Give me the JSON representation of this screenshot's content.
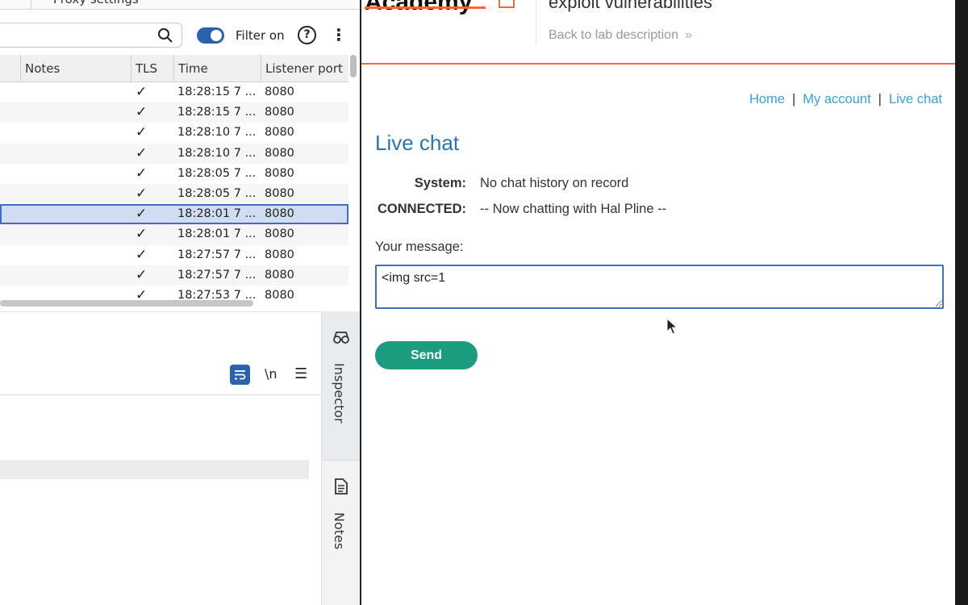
{
  "proxy": {
    "top_cut_text": "Proxy settings",
    "filter": {
      "placeholder": "",
      "filter_label": "Filter on",
      "help_label": "?",
      "more_label": "⋮"
    },
    "columns": [
      "Notes",
      "TLS",
      "Time",
      "Listener port"
    ],
    "rows": [
      {
        "tls": "✓",
        "time": "18:28:15 7 ...",
        "port": "8080"
      },
      {
        "tls": "✓",
        "time": "18:28:15 7 ...",
        "port": "8080"
      },
      {
        "tls": "✓",
        "time": "18:28:10 7 ...",
        "port": "8080"
      },
      {
        "tls": "✓",
        "time": "18:28:10 7 ...",
        "port": "8080"
      },
      {
        "tls": "✓",
        "time": "18:28:05 7 ...",
        "port": "8080"
      },
      {
        "tls": "✓",
        "time": "18:28:05 7 ...",
        "port": "8080"
      },
      {
        "tls": "✓",
        "time": "18:28:01 7 ...",
        "port": "8080"
      },
      {
        "tls": "✓",
        "time": "18:28:01 7 ...",
        "port": "8080"
      },
      {
        "tls": "✓",
        "time": "18:27:57 7 ...",
        "port": "8080"
      },
      {
        "tls": "✓",
        "time": "18:27:57 7 ...",
        "port": "8080"
      },
      {
        "tls": "✓",
        "time": "18:27:53 7 ...",
        "port": "8080"
      }
    ],
    "selected_row": 6,
    "editor": {
      "newline_label": "\\n",
      "menu_label": "☰"
    },
    "side_tabs": {
      "inspector": "Inspector",
      "notes": "Notes"
    }
  },
  "browser": {
    "logo_text": "Academy",
    "lab_title": "exploit vulnerabilities",
    "back_link": "Back to lab description",
    "back_chevron": "»",
    "nav": {
      "home": "Home",
      "account": "My account",
      "chat": "Live chat",
      "separator": "|"
    },
    "heading": "Live chat",
    "chat": [
      {
        "who": "System:",
        "msg": "No chat history on record"
      },
      {
        "who": "CONNECTED:",
        "msg": "-- Now chatting with Hal Pline --"
      }
    ],
    "message_label": "Your message:",
    "message_value": "<img src=1 ",
    "send_label": "Send"
  },
  "colors": {
    "accent_orange": "#ff6633",
    "link_blue": "#3aa0d6",
    "heading_blue": "#2a75b5",
    "send_green": "#1b9c7e",
    "burp_blue": "#2a62ad",
    "selection": "#cfdcf1"
  }
}
